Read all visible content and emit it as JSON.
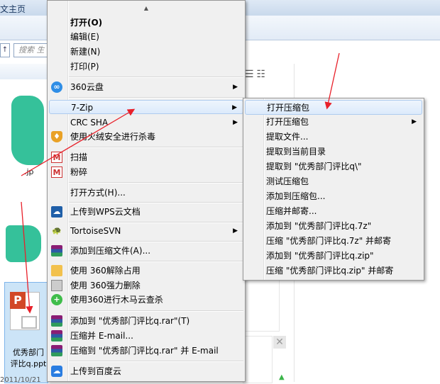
{
  "window": {
    "title_fragment": "文主页",
    "nav_fragment": "↑",
    "search_placeholder": "搜索 生",
    "file1_name": ".jp",
    "file2_name": "优秀部门评比q.ppt",
    "date_fragment": "2011/10/21"
  },
  "context_menu": {
    "items": [
      {
        "label": "打开(O)",
        "bold": true
      },
      {
        "label": "编辑(E)"
      },
      {
        "label": "新建(N)"
      },
      {
        "label": "打印(P)"
      },
      {
        "label": "360云盘",
        "icon": "cloud-360-icon",
        "submenu": true
      },
      {
        "label": "7-Zip",
        "submenu": true
      },
      {
        "label": "CRC SHA",
        "submenu": true
      },
      {
        "label": "使用火绒安全进行杀毒",
        "icon": "huorong-shield-icon"
      },
      {
        "label": "扫描",
        "icon": "mcafee-scan-icon"
      },
      {
        "label": "粉碎",
        "icon": "mcafee-shred-icon"
      },
      {
        "label": "打开方式(H)..."
      },
      {
        "label": "上传到WPS云文档",
        "icon": "wps-cloud-icon"
      },
      {
        "label": "TortoiseSVN",
        "icon": "tortoisesvn-icon",
        "submenu": true
      },
      {
        "label": "添加到压缩文件(A)...",
        "icon": "winrar-icon"
      },
      {
        "label": "使用 360解除占用",
        "icon": "unlock-360-icon"
      },
      {
        "label": "使用 360强力删除",
        "icon": "force-delete-360-icon"
      },
      {
        "label": "使用360进行木马云查杀",
        "icon": "trojan-scan-360-icon"
      },
      {
        "label": "添加到 \"优秀部门评比q.rar\"(T)",
        "icon": "winrar-icon"
      },
      {
        "label": "压缩并 E-mail...",
        "icon": "winrar-icon"
      },
      {
        "label": "压缩到 \"优秀部门评比q.rar\" 并 E-mail",
        "icon": "winrar-icon"
      },
      {
        "label": "上传到百度云",
        "icon": "baidu-cloud-icon"
      }
    ],
    "submenu_arrow": "▶",
    "scroll_up_glyph": "▲"
  },
  "zip_submenu": {
    "items": [
      {
        "label": "打开压缩包"
      },
      {
        "label": "打开压缩包",
        "submenu": true
      },
      {
        "label": "提取文件..."
      },
      {
        "label": "提取到当前目录"
      },
      {
        "label": "提取到 \"优秀部门评比q\\\""
      },
      {
        "label": "测试压缩包"
      },
      {
        "label": "添加到压缩包..."
      },
      {
        "label": "压缩并邮寄..."
      },
      {
        "label": "添加到 \"优秀部门评比q.7z\""
      },
      {
        "label": "压缩 \"优秀部门评比q.7z\" 并邮寄"
      },
      {
        "label": "添加到 \"优秀部门评比q.zip\""
      },
      {
        "label": "压缩 \"优秀部门评比q.zip\" 并邮寄"
      }
    ]
  },
  "colors": {
    "annotation_arrow": "#e8202a",
    "menu_bg": "#f0f0f0",
    "highlight_border": "#aecbee"
  }
}
